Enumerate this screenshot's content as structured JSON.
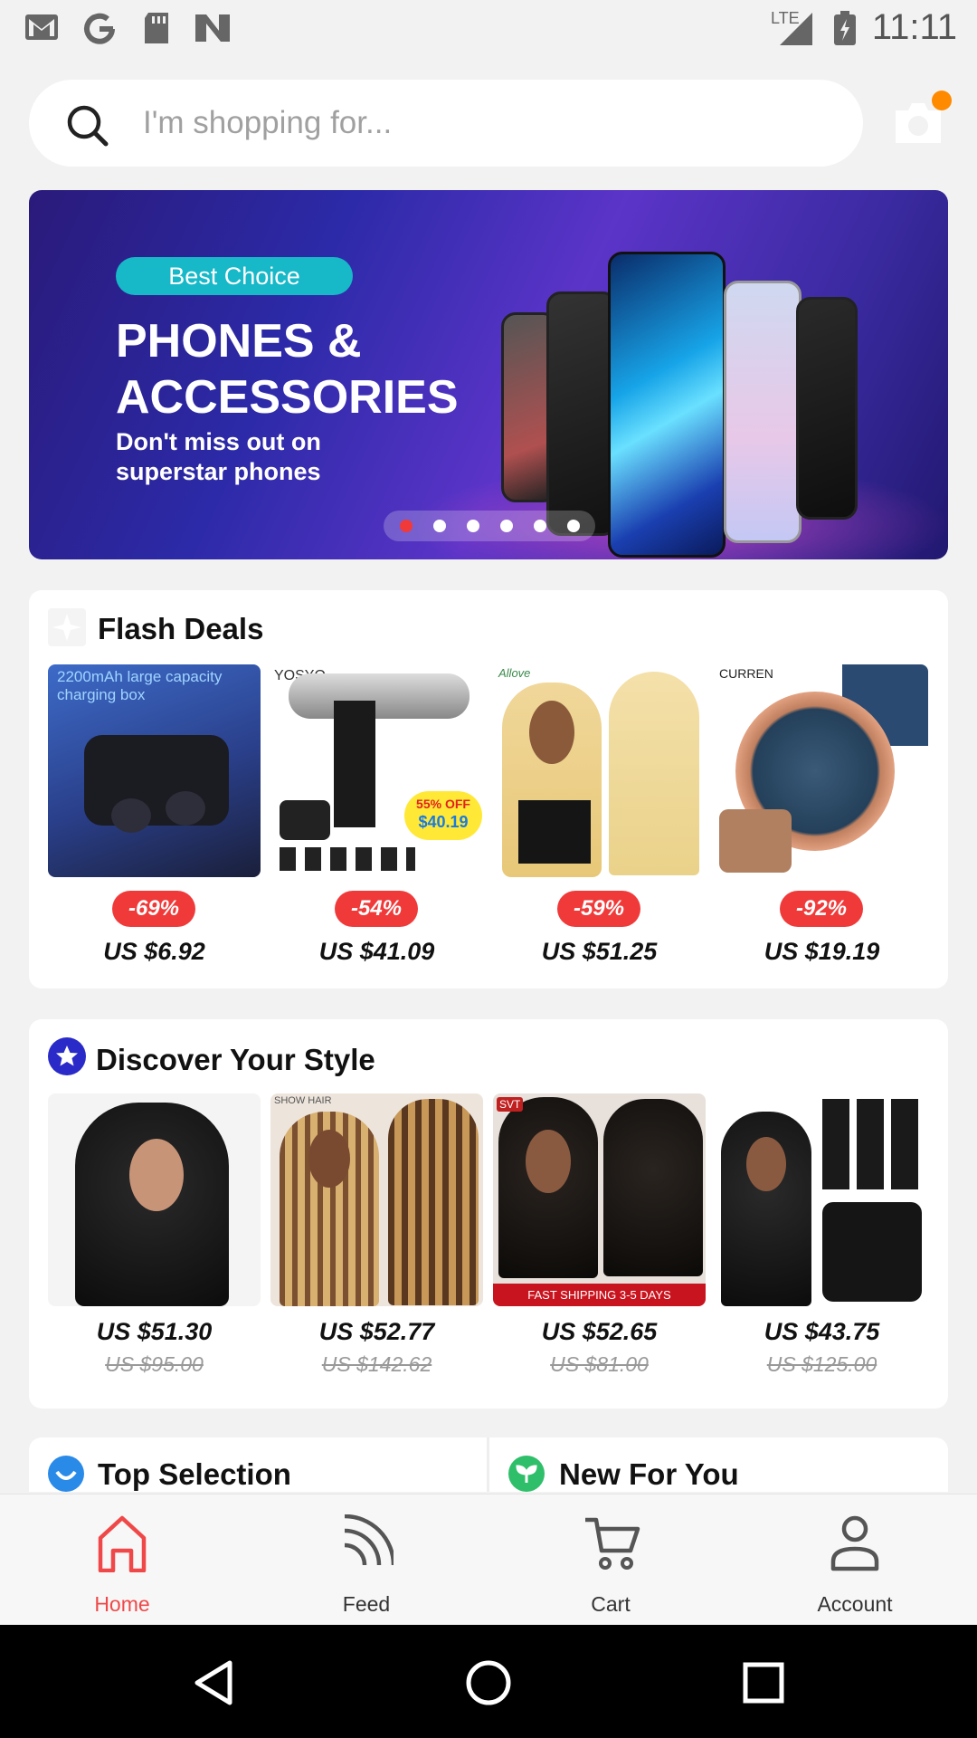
{
  "status_bar": {
    "time": "11:11",
    "network": "LTE"
  },
  "search": {
    "placeholder": "I'm shopping for..."
  },
  "banner": {
    "tag": "Best Choice",
    "headline_line1": "PHONES &",
    "headline_line2": "ACCESSORIES",
    "subline1": "Don't miss out on",
    "subline2": "superstar phones",
    "slide_count": 6,
    "active_slide": 1
  },
  "flash_deals": {
    "title": "Flash Deals",
    "items": [
      {
        "discount": "-69%",
        "price": "US $6.92",
        "image": "earbuds-image",
        "overlay": "2200mAh large capacity charging box"
      },
      {
        "discount": "-54%",
        "price": "US $41.09",
        "image": "massage-gun-image",
        "overlay": "YOSYO",
        "sticker1": "55% OFF",
        "sticker2": "$40.19"
      },
      {
        "discount": "-59%",
        "price": "US $51.25",
        "image": "blonde-wig-image",
        "overlay": "Allove"
      },
      {
        "discount": "-92%",
        "price": "US $19.19",
        "image": "watch-image",
        "overlay": "CURREN"
      }
    ]
  },
  "discover": {
    "title": "Discover Your Style",
    "items": [
      {
        "price": "US $51.30",
        "old_price": "US $95.00",
        "image": "curly-wig-image"
      },
      {
        "price": "US $52.77",
        "old_price": "US $142.62",
        "image": "highlight-wig-image",
        "overlay": "SHOW HAIR"
      },
      {
        "price": "US $52.65",
        "old_price": "US $81.00",
        "image": "curly-wig-2-image",
        "overlay": "SVT",
        "banner": "FAST SHIPPING 3-5 DAYS"
      },
      {
        "price": "US $43.75",
        "old_price": "US $125.00",
        "image": "body-wave-bundle-image"
      }
    ]
  },
  "sections": {
    "top_selection": "Top Selection",
    "new_for_you": "New For You"
  },
  "nav": {
    "items": [
      {
        "label": "Home",
        "icon": "home-icon",
        "active": true
      },
      {
        "label": "Feed",
        "icon": "feed-icon",
        "active": false
      },
      {
        "label": "Cart",
        "icon": "cart-icon",
        "active": false
      },
      {
        "label": "Account",
        "icon": "account-icon",
        "active": false
      }
    ]
  },
  "colors": {
    "accent": "#f03a3a",
    "nav_active": "#f04848",
    "notification": "#ff8a00"
  }
}
